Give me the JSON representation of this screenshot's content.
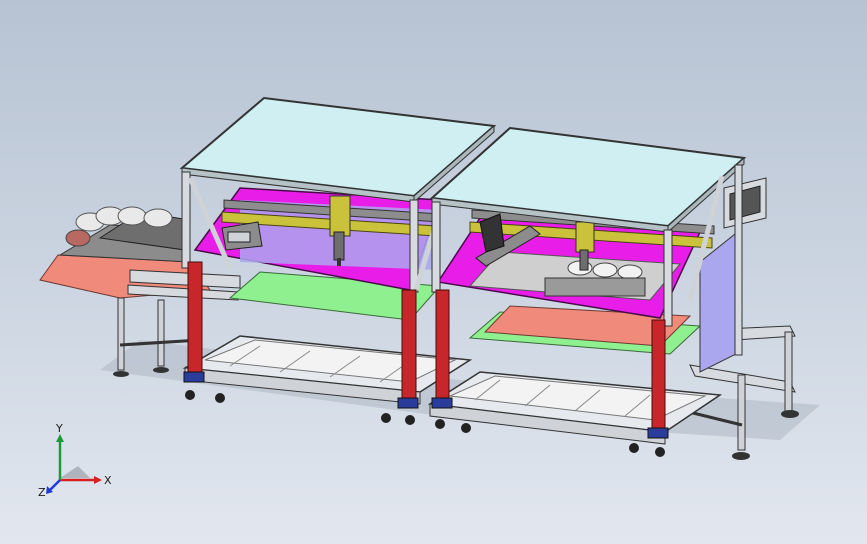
{
  "triad": {
    "x_label": "X",
    "y_label": "Y",
    "z_label": "Z",
    "x_color": "#d81e1e",
    "y_color": "#1e9a3a",
    "z_color": "#1e3ad8"
  },
  "colors": {
    "glass": "#cfeff2",
    "frame": "#d7dadf",
    "magenta_plate": "#e81ee8",
    "yellow_rail": "#c9c23a",
    "red_leg": "#c7262a",
    "green_plate": "#8ef08e",
    "salmon_plate": "#f08a7a",
    "lavender_panel": "#aaa7ee"
  }
}
